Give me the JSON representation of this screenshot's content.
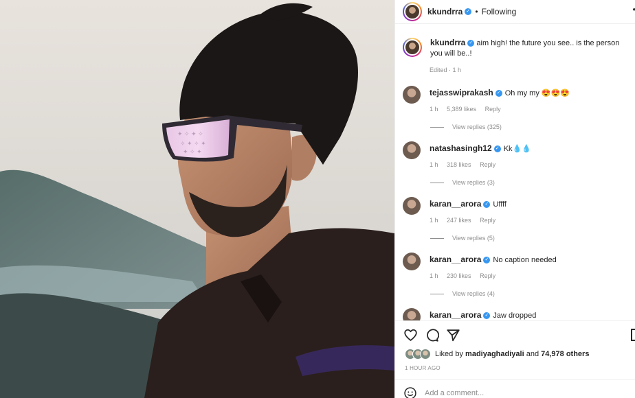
{
  "post": {
    "username": "kkundrra",
    "follow_status": "Following",
    "separator": "•",
    "more_glyph": "•",
    "caption": "aim high! the future you see.. is the person you will be..!",
    "caption_meta": "Edited · 1 h"
  },
  "comments": [
    {
      "username": "tejasswiprakash",
      "text": "Oh my my 😍😍😍",
      "time": "1 h",
      "likes": "5,389 likes",
      "reply": "Reply",
      "replies": "View replies (325)"
    },
    {
      "username": "natashasingh12",
      "text": "Kk💧💧",
      "time": "1 h",
      "likes": "318 likes",
      "reply": "Reply",
      "replies": "View replies (3)"
    },
    {
      "username": "karan__arora",
      "text": "Uffff",
      "time": "1 h",
      "likes": "247 likes",
      "reply": "Reply",
      "replies": "View replies (5)"
    },
    {
      "username": "karan__arora",
      "text": "No caption needed",
      "time": "1 h",
      "likes": "230 likes",
      "reply": "Reply",
      "replies": "View replies (4)"
    },
    {
      "username": "karan__arora",
      "text": "Jaw dropped"
    }
  ],
  "likes": {
    "prefix": "Liked by",
    "user": "madiyaghadiyali",
    "and": "and",
    "others": "74,978 others"
  },
  "timestamp": "1 HOUR AGO",
  "add_comment": {
    "placeholder": "Add a comment..."
  },
  "icons": {
    "like": "heart-icon",
    "comment": "comment-icon",
    "share": "paper-plane-icon",
    "save": "bookmark-icon",
    "emoji": "smiley-icon"
  },
  "colors": {
    "verified": "#3897f0",
    "muted": "#8e8e8e",
    "text": "#262626"
  }
}
